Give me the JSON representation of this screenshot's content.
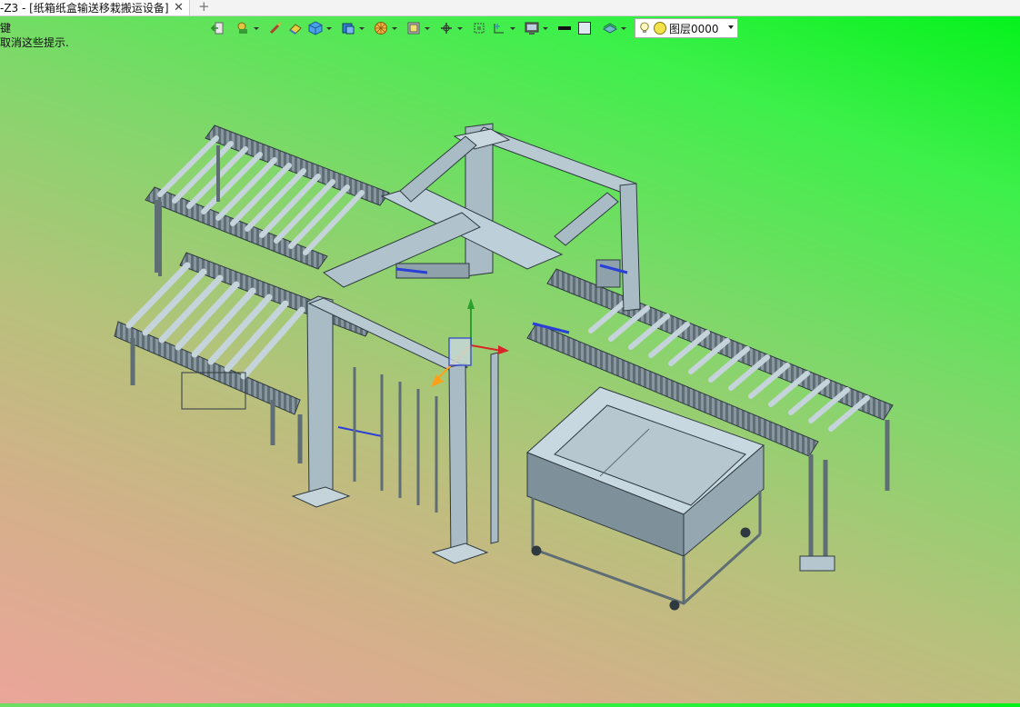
{
  "tab": {
    "title": "-Z3 - [纸箱纸盒输送移栽搬运设备]",
    "close_symbol": "✕",
    "new_tab_symbol": "+"
  },
  "hints": {
    "line1": "键",
    "line2": "取消这些提示."
  },
  "toolbar": {
    "icons": [
      "exit-icon",
      "shape-icon",
      "brush-icon",
      "eraser-icon",
      "cube-icon",
      "box-shaded-icon",
      "sphere-icon",
      "display-mode-icon",
      "axis-icon",
      "frame-icon",
      "grid-icon",
      "monitor-icon",
      "line-weight-icon",
      "color-swatch-icon",
      "layer-stack-icon"
    ]
  },
  "layer": {
    "name": "图层0000"
  },
  "colors": {
    "frame": "#a9bcc6",
    "frame_dark": "#5f6d74",
    "roller": "#b8c8d0",
    "accent_blue": "#2a3fd6"
  }
}
